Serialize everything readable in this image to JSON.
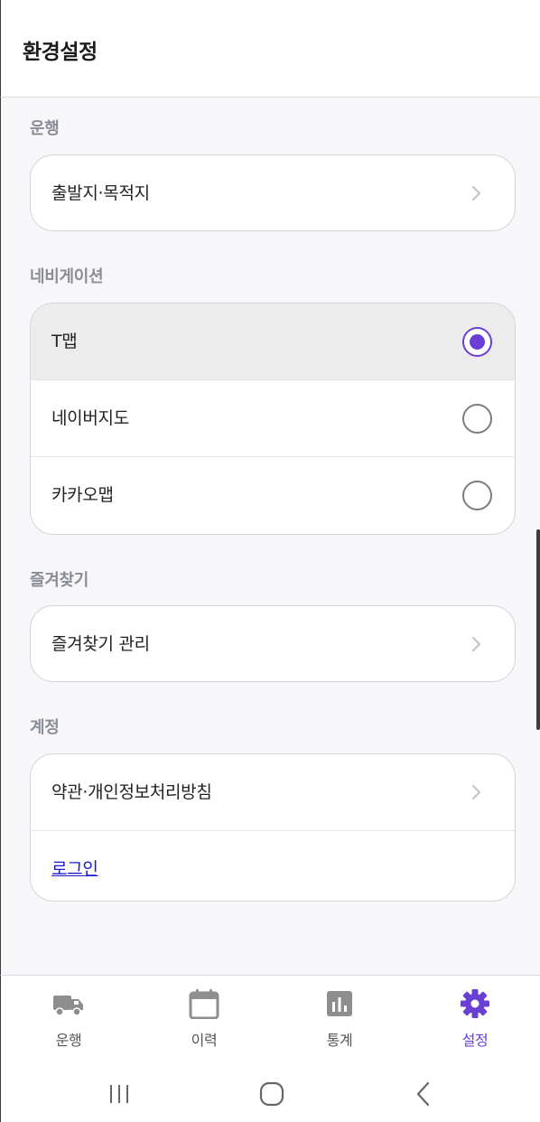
{
  "header": {
    "title": "환경설정"
  },
  "sections": {
    "drive": {
      "label": "운행",
      "items": [
        {
          "label": "출발지·목적지"
        }
      ]
    },
    "navigation": {
      "label": "네비게이션",
      "options": [
        {
          "label": "T맵",
          "selected": true
        },
        {
          "label": "네이버지도",
          "selected": false
        },
        {
          "label": "카카오맵",
          "selected": false
        }
      ]
    },
    "favorites": {
      "label": "즐겨찾기",
      "items": [
        {
          "label": "즐겨찾기 관리"
        }
      ]
    },
    "account": {
      "label": "계정",
      "items": [
        {
          "label": "약관·개인정보처리방침"
        }
      ],
      "login_label": "로그인"
    }
  },
  "tabbar": {
    "tabs": [
      {
        "label": "운행",
        "icon": "truck-icon",
        "active": false
      },
      {
        "label": "이력",
        "icon": "calendar-icon",
        "active": false
      },
      {
        "label": "통계",
        "icon": "bar-chart-icon",
        "active": false
      },
      {
        "label": "설정",
        "icon": "gear-icon",
        "active": true
      }
    ]
  },
  "colors": {
    "accent": "#6a3fd4",
    "section_label": "#8a8d96",
    "link": "#1a1ad0",
    "inactive_icon": "#8e8e8e"
  }
}
